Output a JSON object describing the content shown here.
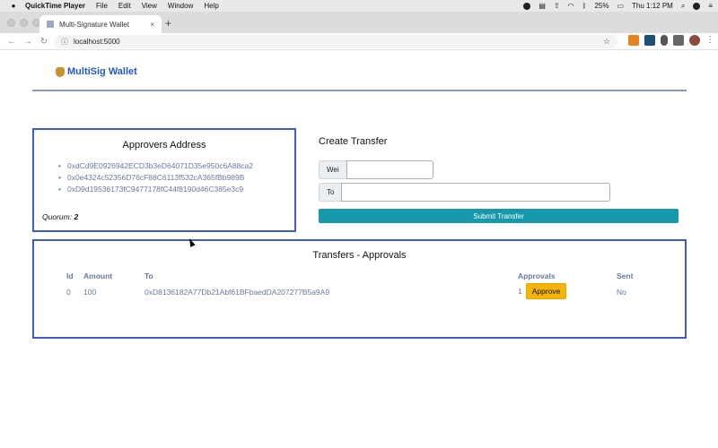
{
  "menubar": {
    "app_name": "QuickTime Player",
    "items": [
      "File",
      "Edit",
      "View",
      "Window",
      "Help"
    ],
    "battery": "25%",
    "clock": "Thu 1:12 PM"
  },
  "browser": {
    "tab_title": "Multi-Signature Wallet",
    "tab_close": "×",
    "new_tab": "+",
    "url": "localhost:5000"
  },
  "page": {
    "brand": "MultiSig Wallet",
    "approvers": {
      "title": "Approvers Address",
      "addresses": [
        "0xdCd9E0926942ECD3b3eD64071D35e950c6A88ca2",
        "0x0e4324c52356D76cF88C6113f532cA365fBb989B",
        "0xD9d19536173fC9477178fC44f8190d46C385e3c9"
      ],
      "quorum_label": "Quorum:",
      "quorum_value": "2"
    },
    "create_transfer": {
      "title": "Create Transfer",
      "wei_label": "Wei",
      "wei_value": "",
      "to_label": "To",
      "to_value": "",
      "submit_label": "Submit Transfer"
    },
    "transfers": {
      "title": "Transfers - Approvals",
      "columns": [
        "Id",
        "Amount",
        "To",
        "Approvals",
        "Sent"
      ],
      "rows": [
        {
          "id": "0",
          "amount": "100",
          "to": "0xD8136182A77Db21Abf61BFbaedDA207277B5a9A9",
          "approvals": "1",
          "approve_label": "Approve",
          "sent": "No"
        }
      ]
    }
  },
  "colors": {
    "accent_blue": "#3b5bd0",
    "submit_teal": "#1698ad",
    "approve_yellow": "#f6b40a",
    "muted_text": "#6679a6"
  }
}
